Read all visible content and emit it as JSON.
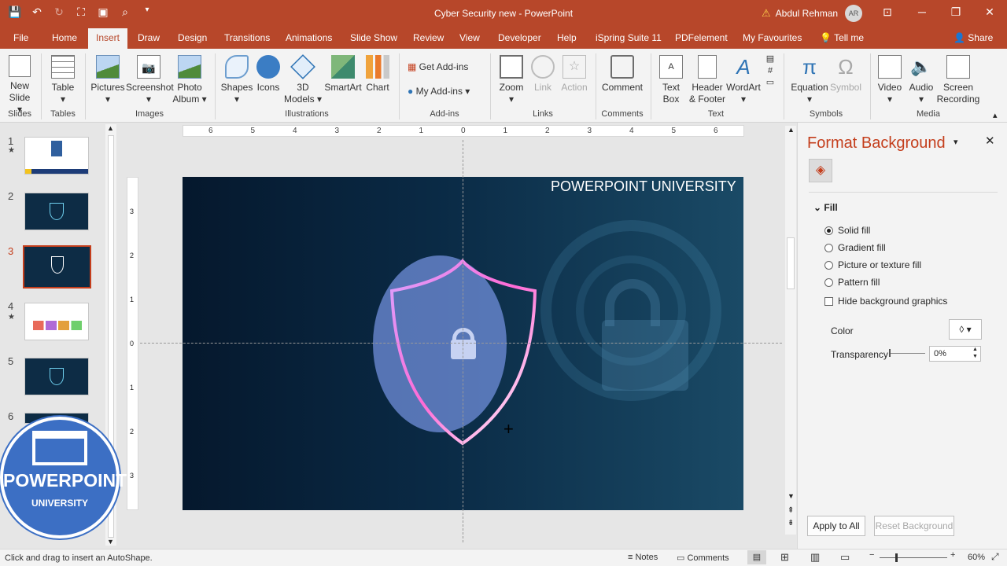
{
  "titlebar": {
    "doc_title": "Cyber Security new  -  PowerPoint",
    "user_name": "Abdul Rehman",
    "avatar": "AR"
  },
  "tabs": [
    "File",
    "Home",
    "Insert",
    "Draw",
    "Design",
    "Transitions",
    "Animations",
    "Slide Show",
    "Review",
    "View",
    "Developer",
    "Help",
    "iSpring Suite 11",
    "PDFelement",
    "My Favourites",
    "Tell me",
    "Share"
  ],
  "active_tab": "Insert",
  "ribbon": {
    "new_slide": "New",
    "new_slide2": "Slide",
    "table": "Table",
    "pictures": "Pictures",
    "screenshot": "Screenshot",
    "photo": "Photo",
    "album": "Album",
    "shapes": "Shapes",
    "icons": "Icons",
    "d3": "3D",
    "models": "Models",
    "smartart": "SmartArt",
    "chart": "Chart",
    "get_addins": "Get Add-ins",
    "my_addins": "My Add-ins",
    "zoom": "Zoom",
    "link": "Link",
    "action": "Action",
    "comment": "Comment",
    "text": "Text",
    "box": "Box",
    "header": "Header",
    "footer": "& Footer",
    "wordart": "WordArt",
    "equation": "Equation",
    "symbol": "Symbol",
    "video": "Video",
    "audio": "Audio",
    "screen": "Screen",
    "recording": "Recording",
    "groups": {
      "slides": "Slides",
      "tables": "Tables",
      "images": "Images",
      "illustrations": "Illustrations",
      "addins": "Add-ins",
      "links": "Links",
      "comments": "Comments",
      "text": "Text",
      "symbols": "Symbols",
      "media": "Media"
    }
  },
  "thumbnails": [
    "1",
    "2",
    "3",
    "4",
    "5",
    "6"
  ],
  "slide": {
    "brand_text": "POWERPOINT UNIVERSITY"
  },
  "logo": {
    "line1": "POWERPOINT",
    "line2": "UNIVERSITY"
  },
  "ruler": {
    "h": [
      "6",
      "5",
      "4",
      "3",
      "2",
      "1",
      "0",
      "1",
      "2",
      "3",
      "4",
      "5",
      "6"
    ],
    "v": [
      "3",
      "2",
      "1",
      "0",
      "1",
      "2",
      "3"
    ]
  },
  "panel": {
    "title": "Format Background",
    "section": "Fill",
    "options": [
      "Solid fill",
      "Gradient fill",
      "Picture or texture fill",
      "Pattern fill"
    ],
    "selected": "Solid fill",
    "hide_bg": "Hide background graphics",
    "color_label": "Color",
    "transparency_label": "Transparency",
    "transparency_value": "0%",
    "apply_all": "Apply to All",
    "reset": "Reset Background"
  },
  "status": {
    "hint": "Click and drag to insert an AutoShape.",
    "notes": "Notes",
    "comments": "Comments",
    "zoom": "60%"
  },
  "colors": {
    "accent": "#b7472a",
    "panel_title": "#c43e1c",
    "slide_bg": "#0a2a45"
  }
}
